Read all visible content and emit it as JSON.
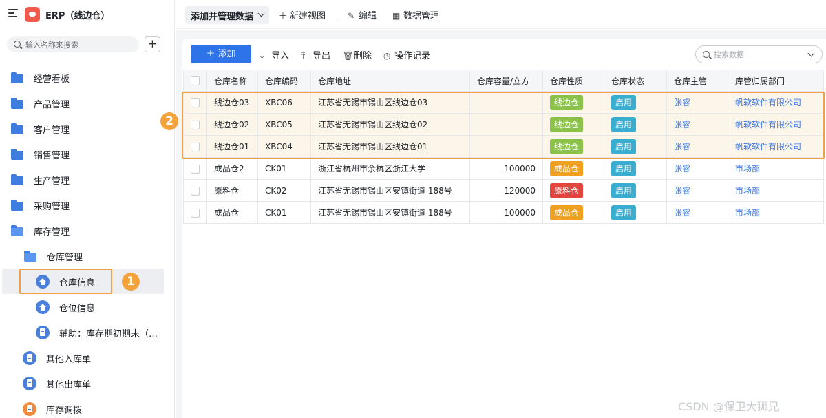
{
  "app": {
    "title": "ERP（线边仓）"
  },
  "sidebar": {
    "search_placeholder": "输入名称来搜索",
    "add_symbol": "+",
    "groups": [
      {
        "label": "经营看板",
        "icon": "folder-icon"
      },
      {
        "label": "产品管理",
        "icon": "folder-icon"
      },
      {
        "label": "客户管理",
        "icon": "folder-icon"
      },
      {
        "label": "销售管理",
        "icon": "folder-icon"
      },
      {
        "label": "生产管理",
        "icon": "folder-icon"
      },
      {
        "label": "采购管理",
        "icon": "folder-icon"
      },
      {
        "label": "库存管理",
        "icon": "folder-open-icon"
      }
    ],
    "subgroup": {
      "label": "仓库管理",
      "icon": "folder-open-icon"
    },
    "sub_items": [
      {
        "label": "仓库信息",
        "icon": "home-icon",
        "active": true
      },
      {
        "label": "仓位信息",
        "icon": "home-icon"
      },
      {
        "label": "辅助：库存期初期末（…",
        "icon": "document-icon"
      }
    ],
    "items": [
      {
        "label": "其他入库单",
        "icon": "document-icon"
      },
      {
        "label": "其他出库单",
        "icon": "document-icon"
      },
      {
        "label": "库存调拨",
        "icon": "transfer-icon"
      }
    ]
  },
  "toolbar": {
    "dropdown_label": "添加并管理数据",
    "new_view": "新建视图",
    "edit": "编辑",
    "data_manage": "数据管理"
  },
  "actions": {
    "add": "添加",
    "import": "导入",
    "export": "导出",
    "delete": "删除",
    "history": "操作记录",
    "search_placeholder": "搜索数据"
  },
  "table": {
    "columns": [
      "仓库名称",
      "仓库编码",
      "仓库地址",
      "仓库容量/立方",
      "仓库性质",
      "仓库状态",
      "仓库主管",
      "库管归属部门"
    ],
    "rows": [
      {
        "name": "线边仓03",
        "code": "XBC06",
        "address": "江苏省无锡市锡山区线边仓03",
        "capacity": "",
        "nature": "线边仓",
        "nature_color": "#8bc34a",
        "status": "启用",
        "manager": "张睿",
        "dept": "帆软软件有限公司",
        "highlighted": true
      },
      {
        "name": "线边仓02",
        "code": "XBC05",
        "address": "江苏省无锡市锡山区线边仓02",
        "capacity": "",
        "nature": "线边仓",
        "nature_color": "#8bc34a",
        "status": "启用",
        "manager": "张睿",
        "dept": "帆软软件有限公司",
        "highlighted": true
      },
      {
        "name": "线边仓01",
        "code": "XBC04",
        "address": "江苏省无锡市锡山区线边仓01",
        "capacity": "",
        "nature": "线边仓",
        "nature_color": "#8bc34a",
        "status": "启用",
        "manager": "张睿",
        "dept": "帆软软件有限公司",
        "highlighted": true
      },
      {
        "name": "成品仓2",
        "code": "CK01",
        "address": "浙江省杭州市余杭区浙江大学",
        "capacity": "100000",
        "nature": "成品仓",
        "nature_color": "#f0a020",
        "status": "启用",
        "manager": "张睿",
        "dept": "市场部",
        "highlighted": false
      },
      {
        "name": "原料仓",
        "code": "CK02",
        "address": "江苏省无锡市锡山区安镇街道 188号",
        "capacity": "120000",
        "nature": "原料仓",
        "nature_color": "#e4463f",
        "status": "启用",
        "manager": "张睿",
        "dept": "市场部",
        "highlighted": false
      },
      {
        "name": "成品仓",
        "code": "CK01",
        "address": "江苏省无锡市锡山区安镇街道 188号",
        "capacity": "100000",
        "nature": "成品仓",
        "nature_color": "#f0a020",
        "status": "启用",
        "manager": "张睿",
        "dept": "市场部",
        "highlighted": false
      }
    ]
  },
  "annotations": {
    "badge_1": "1",
    "badge_2": "2"
  },
  "watermark": "CSDN @保卫大狮兄"
}
